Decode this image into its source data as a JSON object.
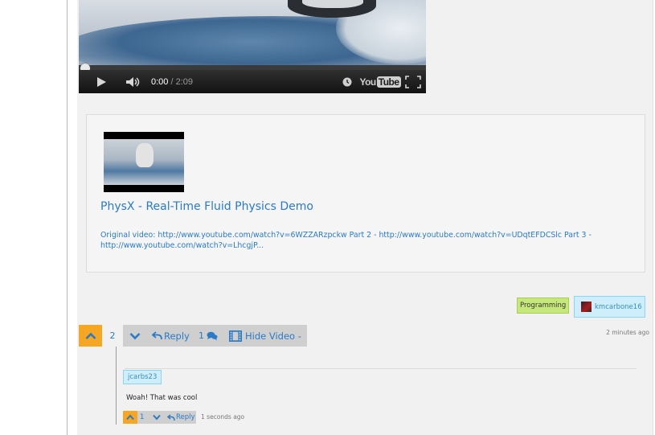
{
  "video_player": {
    "current_time": "0:00",
    "separator": " / ",
    "duration": "2:09",
    "progress_fraction": 0.0,
    "logo_you": "You",
    "logo_tube": "Tube",
    "icons": [
      "play-icon",
      "volume-icon",
      "clock-icon",
      "youtube-logo",
      "fullscreen-icon"
    ]
  },
  "embed_card": {
    "title": "PhysX - Real-Time Fluid Physics Demo",
    "description": "Original video: http://www.youtube.com/watch?v=6WZZARzpckw Part 2 - http://www.youtube.com/watch?v=UDqtEFDCSlc Part 3 - http://www.youtube.com/watch?v=LhcgjP..."
  },
  "tags": {
    "category": "Programming",
    "author": "kmcarbone16"
  },
  "post_actions": {
    "score": "2",
    "reply_label": "Reply",
    "comment_count": "1",
    "hide_video_label": "Hide Video -",
    "posted_time": "2 minutes ago"
  },
  "comments": [
    {
      "user": "jcarbs23",
      "text": "Woah! That was cool",
      "score": "1",
      "reply_label": "Reply",
      "time": "1 seconds ago"
    }
  ],
  "colors": {
    "link_blue": "#2a7ac8",
    "vote_orange": "#f5a623",
    "category_green": "#c6e87a",
    "user_tag_blue": "#cdeefa"
  }
}
